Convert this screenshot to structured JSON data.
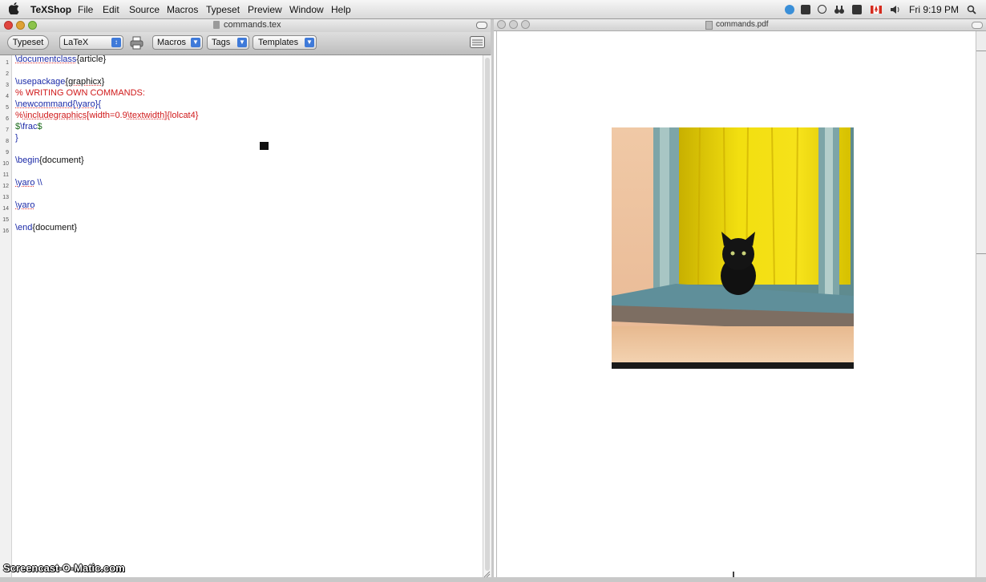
{
  "menubar": {
    "app_name": "TeXShop",
    "items": [
      "File",
      "Edit",
      "Source",
      "Macros",
      "Typeset",
      "Preview",
      "Window",
      "Help"
    ],
    "clock": "Fri 9:19 PM"
  },
  "editor": {
    "window_title": "commands.tex",
    "toolbar": {
      "typeset_label": "Typeset",
      "engine_value": "LaTeX",
      "macros_label": "Macros",
      "tags_label": "Tags",
      "templates_label": "Templates"
    },
    "line_numbers": [
      "1",
      "2",
      "3",
      "4",
      "5",
      "6",
      "7",
      "8",
      "9",
      "10",
      "11",
      "12",
      "13",
      "14",
      "15",
      "16"
    ],
    "lines": {
      "l1a": "\\documentclass",
      "l1b": "{article}",
      "l3a": "\\usepackage",
      "l3b": "{graphicx}",
      "l4": "% WRITING OWN COMMANDS:",
      "l5a": "\\newcommand",
      "l5b": "{",
      "l5c": "\\yaro",
      "l5d": "}{",
      "l6a": "%",
      "l6b": "\\includegraphics",
      "l6c": "[width=0.9",
      "l6d": "\\textwidth",
      "l6e": "]{lolcat4}",
      "l7a": "$",
      "l7b": "\\frac",
      "l7c": "$",
      "l8": "}",
      "l10a": "\\begin",
      "l10b": "{document}",
      "l12a": "\\yaro",
      "l12b": " \\\\",
      "l14": "\\yaro",
      "l16a": "\\end",
      "l16b": "{document}"
    }
  },
  "pdf": {
    "window_title": "commands.pdf"
  },
  "watermark": "Screencast-O-Matic.com",
  "colors": {
    "command": "#1b2aa8",
    "comment": "#d0191a",
    "select_arrow": "#3f7ad9"
  }
}
